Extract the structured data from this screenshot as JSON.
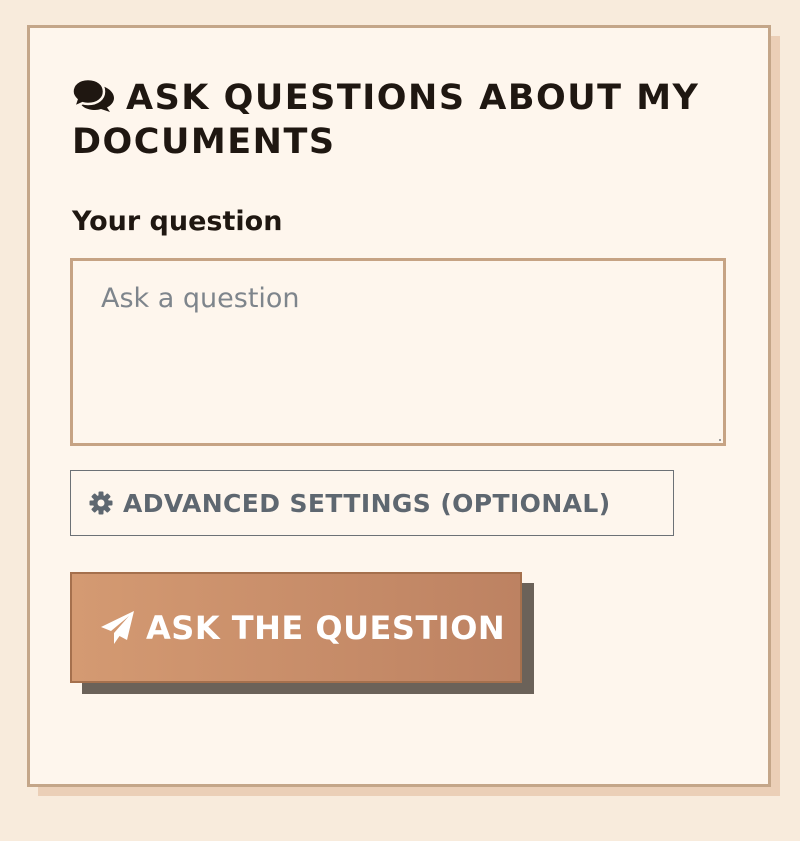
{
  "panel": {
    "title": "Ask questions about my documents",
    "title_icon": "chat-icon"
  },
  "question": {
    "label": "Your question",
    "placeholder": "Ask a question",
    "value": ""
  },
  "advanced": {
    "label": "Advanced settings (optional)",
    "icon": "gear-icon"
  },
  "ask": {
    "label": "Ask the question",
    "icon": "send-icon"
  },
  "colors": {
    "page_background": "#f8ebdc",
    "card_background": "#fef6ed",
    "card_border": "#c4a689",
    "button_gradient_start": "#d49a72",
    "button_gradient_end": "#bd8262",
    "button_shadow": "#6b6259",
    "muted_text": "#5e6770"
  }
}
